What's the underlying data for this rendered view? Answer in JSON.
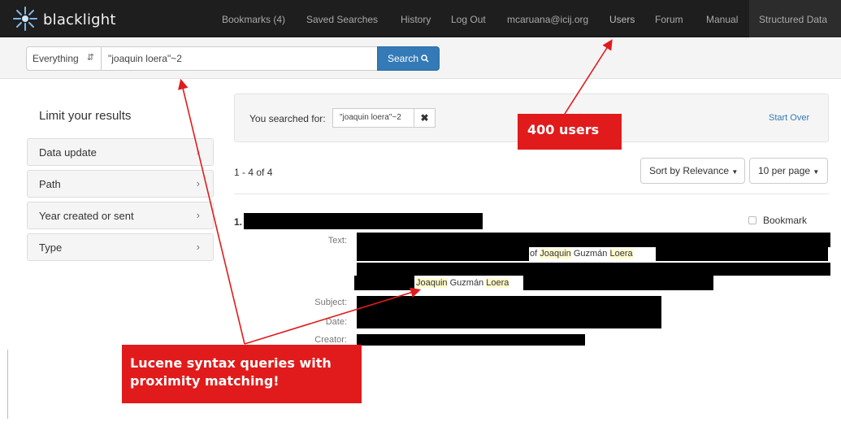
{
  "nav": {
    "brand": "blacklight",
    "links": [
      "Bookmarks (4)",
      "Saved Searches",
      "History",
      "Log Out",
      "mcaruana@icij.org",
      "Users",
      "Forum",
      "Manual"
    ],
    "structured_data": "Structured Data"
  },
  "search": {
    "field": "Everything",
    "query": "\"joaquin loera\"~2",
    "button": "Search"
  },
  "sidebar": {
    "title": "Limit your results",
    "facets": [
      "Data update",
      "Path",
      "Year created or sent",
      "Type"
    ]
  },
  "constraints": {
    "label": "You searched for:",
    "value": "\"joaquin loera\"~2",
    "start_over": "Start Over"
  },
  "results": {
    "count": "1 - 4 of 4",
    "sort": "Sort by Relevance",
    "per_page": "10 per page",
    "item": {
      "number": "1.",
      "bookmark": "Bookmark",
      "labels": {
        "text": "Text:",
        "subject": "Subject:",
        "date": "Date:",
        "creator": "Creator:"
      },
      "snippet1": {
        "pre": "of ",
        "h1": "Joaquin",
        "mid": " Guzmán ",
        "h2": "Loera"
      },
      "snippet2": {
        "h1": "Joaquin",
        "mid": " Guzmán ",
        "h2": "Loera"
      }
    }
  },
  "annotations": {
    "users_callout": "400 users",
    "lucene_line1": "Lucene syntax queries with",
    "lucene_line2": "proximity matching!"
  },
  "colors": {
    "callout": "#e11b1b",
    "navbar": "#1e1e1e",
    "primary": "#337ab7",
    "highlight": "#fffacd"
  },
  "icons": [
    "blacklight-logo-icon",
    "select-caret-icon",
    "search-icon",
    "close-icon",
    "chevron-right-icon",
    "dropdown-caret-icon",
    "checkbox-icon"
  ]
}
